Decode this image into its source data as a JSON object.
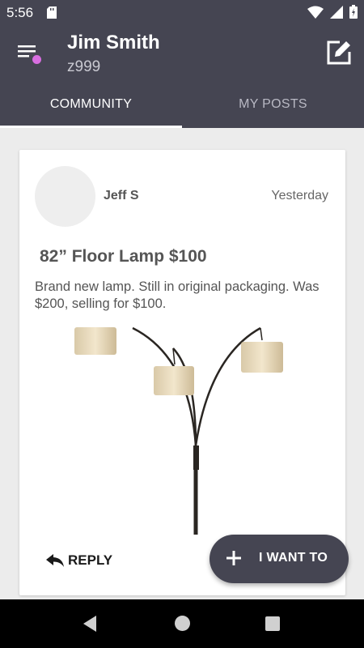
{
  "status_bar": {
    "time": "5:56",
    "icons": [
      "sd-card-icon",
      "wifi-icon",
      "signal-icon",
      "battery-icon"
    ]
  },
  "app_bar": {
    "user_name": "Jim Smith",
    "user_id": "z999",
    "menu_icon": "menu-icon",
    "edit_icon": "edit-icon",
    "notification_dot_color": "#d86ee0"
  },
  "tabs": [
    {
      "label": "COMMUNITY",
      "active": true
    },
    {
      "label": "MY POSTS",
      "active": false
    }
  ],
  "post": {
    "author": "Jeff S",
    "date": "Yesterday",
    "title": "82” Floor Lamp $100",
    "body": "Brand new lamp. Still in original packaging. Was $200, selling for $100.",
    "image": "floor-lamp-image",
    "reply_label": "REPLY"
  },
  "fab": {
    "label": "I WANT TO"
  },
  "colors": {
    "primary": "#454552",
    "accent": "#d86ee0",
    "background": "#ececec"
  }
}
